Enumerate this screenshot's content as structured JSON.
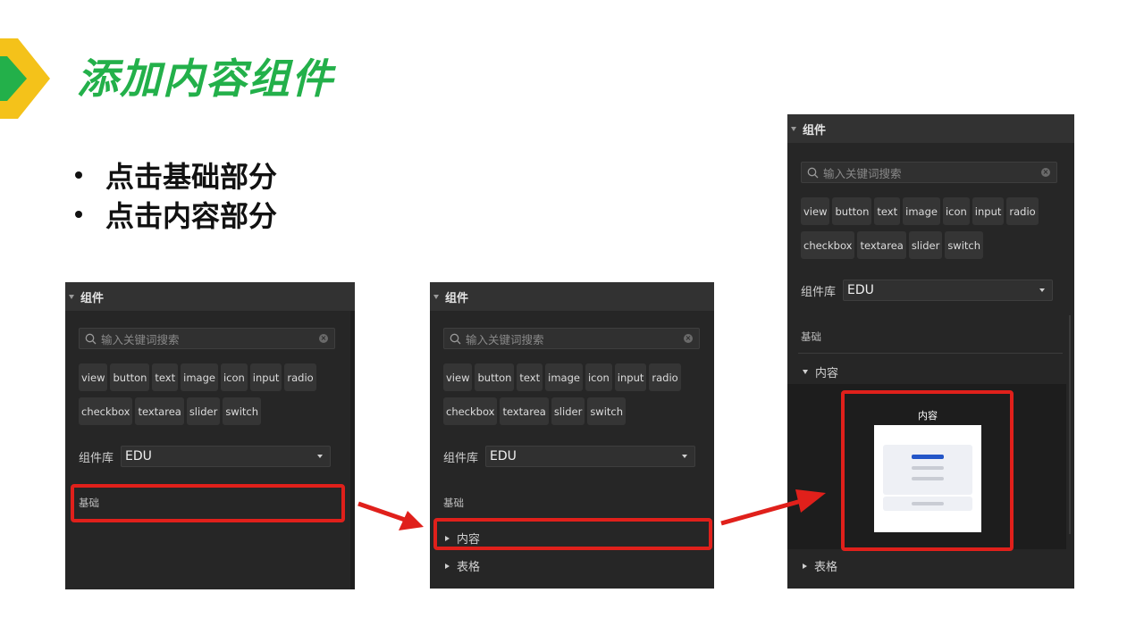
{
  "slide": {
    "title": "添加内容组件",
    "bullets": [
      "点击基础部分",
      "点击内容部分"
    ]
  },
  "colors": {
    "title_green": "#23b04a",
    "logo_yellow": "#f4c21a",
    "logo_green": "#23b04a",
    "highlight_red": "#e0201b",
    "panel_bg": "#262626"
  },
  "panel": {
    "header": "组件",
    "search_placeholder": "输入关键词搜索",
    "tags_row1": [
      "view",
      "button",
      "text",
      "image",
      "icon",
      "input",
      "radio"
    ],
    "tags_row2": [
      "checkbox",
      "textarea",
      "slider",
      "switch"
    ],
    "library_label": "组件库",
    "library_value": "EDU",
    "section_basic": "基础",
    "item_content": "内容",
    "item_table": "表格",
    "preview_label": "内容"
  },
  "icons": [
    "collapse-triangle-icon",
    "search-icon",
    "clear-icon",
    "dropdown-caret-icon",
    "expand-triangle-icon",
    "arrow-icon"
  ]
}
